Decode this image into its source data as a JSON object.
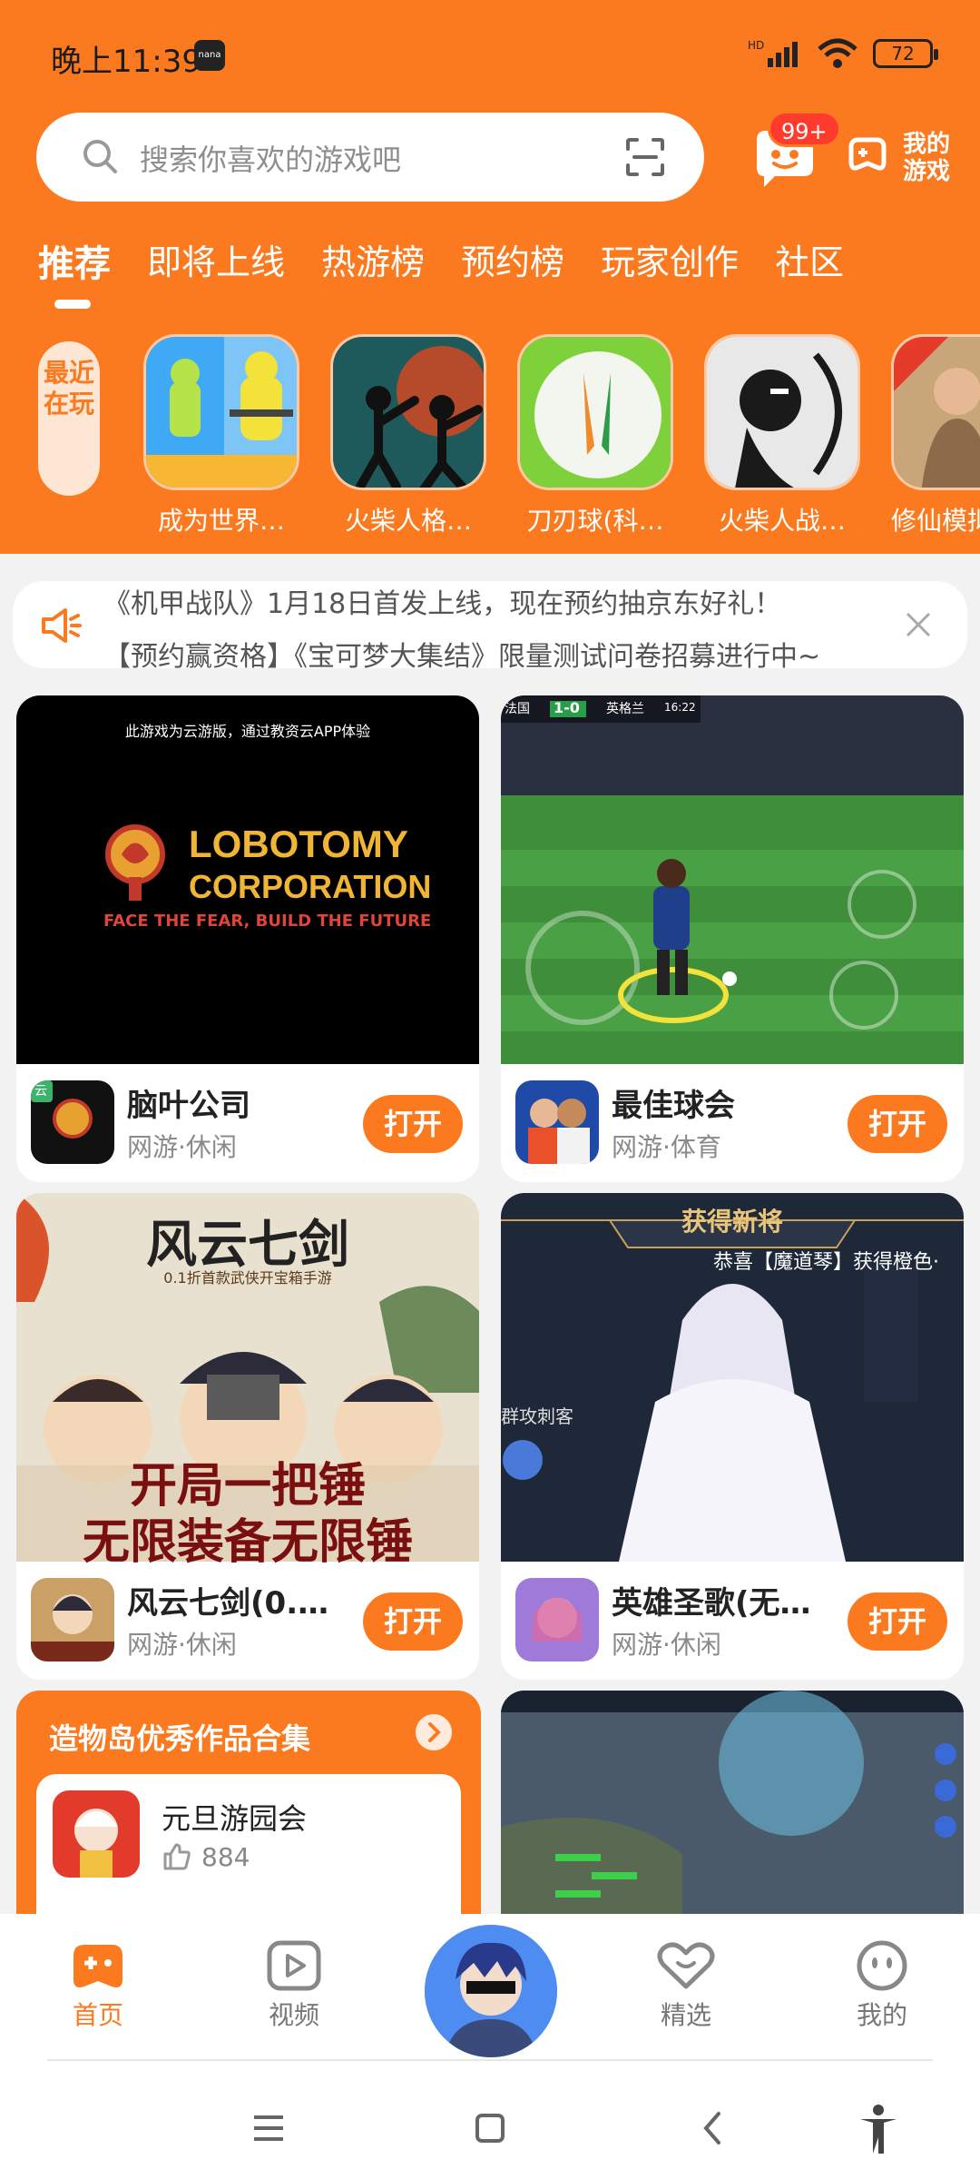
{
  "status_bar": {
    "time": "晚上11:39",
    "badge": "nana",
    "network": "HD",
    "battery": "72"
  },
  "search": {
    "placeholder": "搜索你喜欢的游戏吧"
  },
  "header": {
    "messages_badge": "99+",
    "my_games_label": "我的游戏"
  },
  "tabs": [
    {
      "label": "推荐",
      "active": true
    },
    {
      "label": "即将上线"
    },
    {
      "label": "热游榜"
    },
    {
      "label": "预约榜"
    },
    {
      "label": "玩家创作"
    },
    {
      "label": "社区"
    }
  ],
  "recent": {
    "tag": "最近在玩",
    "items": [
      {
        "name": "成为世界…",
        "icon": "level-game-icon"
      },
      {
        "name": "火柴人格…",
        "icon": "stickman-fight-icon"
      },
      {
        "name": "刀刃球(科…",
        "icon": "blade-ball-icon"
      },
      {
        "name": "火柴人战…",
        "icon": "stickman-war-icon"
      },
      {
        "name": "修仙模拟",
        "icon": "cultivation-icon"
      }
    ]
  },
  "notice": {
    "lines": [
      "《机甲战队》1月18日首发上线，现在预约抽京东好礼！",
      "【预约赢资格】《宝可梦大集结》限量测试问卷招募进行中~"
    ]
  },
  "cards": [
    {
      "banner_caption": "此游戏为云游版，通过教资云APP体验",
      "banner_brand_1": "LOBOTOMY",
      "banner_brand_2": "CORPORATION",
      "banner_slogan": "FACE THE FEAR, BUILD THE FUTURE",
      "title": "脑叶公司",
      "sub": "网游·休闲",
      "cloud_tag": "云",
      "button": "打开"
    },
    {
      "banner_score": "1-0",
      "banner_team_left": "法国",
      "banner_team_right": "英格兰",
      "banner_clock": "16:22",
      "title": "最佳球会",
      "sub": "网游·体育",
      "button": "打开"
    },
    {
      "banner_title": "风云七剑",
      "banner_sub": "0.1折首款武侠开宝箱手游",
      "banner_line1": "开局一把锤",
      "banner_line2": "无限装备无限锤",
      "title": "风云七剑(0.1…",
      "sub": "网游·休闲",
      "button": "打开"
    },
    {
      "banner_title": "获得新将",
      "banner_caption": "恭喜【魔道琴】获得橙色·",
      "banner_side": "群攻刺客",
      "title": "英雄圣歌(无限…",
      "sub": "网游·休闲",
      "button": "打开"
    }
  ],
  "island": {
    "title": "造物岛优秀作品合集",
    "item_name": "元旦游园会",
    "likes": "884"
  },
  "bottom_nav": [
    {
      "label": "首页",
      "active": true
    },
    {
      "label": "视频"
    },
    {
      "label": "精选"
    },
    {
      "label": "我的"
    }
  ],
  "colors": {
    "accent": "#fb7a1f",
    "badge_red": "#ff3b2d"
  }
}
